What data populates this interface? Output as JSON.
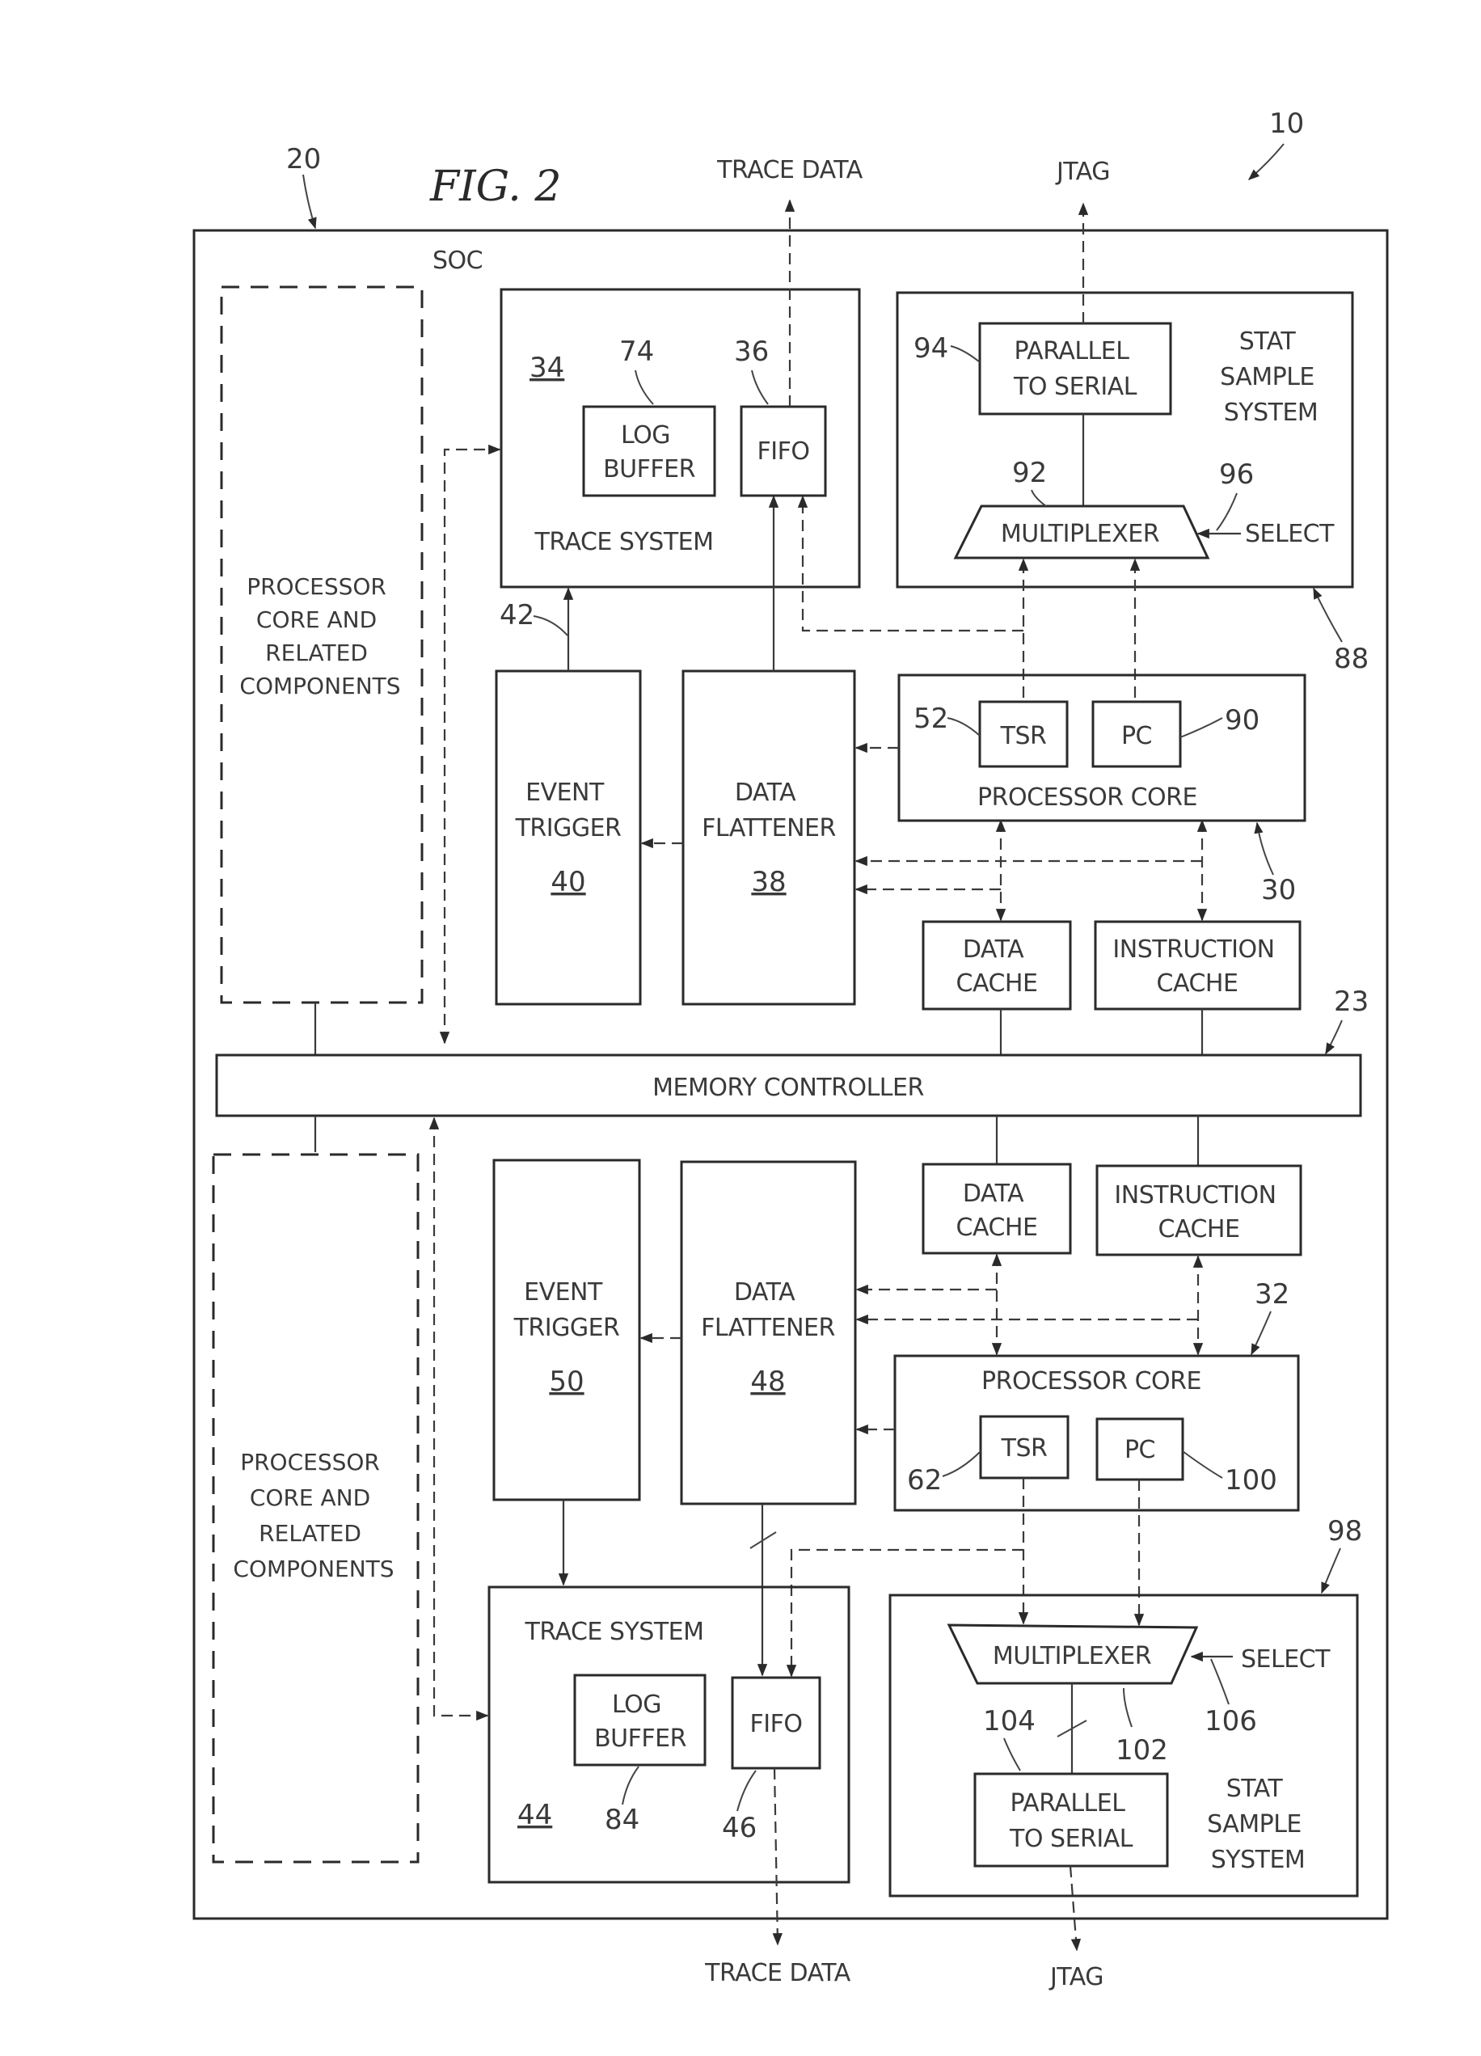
{
  "figure": {
    "title": "FIG. 2",
    "system_ref": "10",
    "soc_ref": "20",
    "soc_label": "SOC"
  },
  "external": {
    "trace_data_top": "TRACE DATA",
    "jtag_top": "JTAG",
    "trace_data_bottom": "TRACE DATA",
    "jtag_bottom": "JTAG"
  },
  "memory_controller": {
    "label": "MEMORY CONTROLLER",
    "ref": "23"
  },
  "upper": {
    "other_core": {
      "lines": [
        "PROCESSOR",
        "CORE AND",
        "RELATED",
        "COMPONENTS"
      ]
    },
    "trace_system": {
      "label": "TRACE SYSTEM",
      "ref": "34"
    },
    "log_buffer": {
      "lines": [
        "LOG",
        "BUFFER"
      ],
      "ref": "74"
    },
    "fifo": {
      "label": "FIFO",
      "ref": "36"
    },
    "stat_sample": {
      "lines": [
        "STAT",
        "SAMPLE",
        "SYSTEM"
      ],
      "ref": "88"
    },
    "parallel_to_serial": {
      "lines": [
        "PARALLEL",
        "TO SERIAL"
      ],
      "ref": "94"
    },
    "multiplexer": {
      "label": "MULTIPLEXER",
      "ref": "92"
    },
    "select": {
      "label": "SELECT",
      "ref": "96"
    },
    "event_trigger": {
      "lines": [
        "EVENT",
        "TRIGGER"
      ],
      "ref": "40",
      "link_ref": "42"
    },
    "data_flattener": {
      "lines": [
        "DATA",
        "FLATTENER"
      ],
      "ref": "38"
    },
    "processor_core": {
      "label": "PROCESSOR CORE",
      "ref": "30"
    },
    "tsr": {
      "label": "TSR",
      "ref": "52"
    },
    "pc": {
      "label": "PC",
      "ref": "90"
    },
    "data_cache": {
      "lines": [
        "DATA",
        "CACHE"
      ]
    },
    "instruction_cache": {
      "lines": [
        "INSTRUCTION",
        "CACHE"
      ]
    }
  },
  "lower": {
    "other_core": {
      "lines": [
        "PROCESSOR",
        "CORE AND",
        "RELATED",
        "COMPONENTS"
      ]
    },
    "data_cache": {
      "lines": [
        "DATA",
        "CACHE"
      ]
    },
    "instruction_cache": {
      "lines": [
        "INSTRUCTION",
        "CACHE"
      ]
    },
    "event_trigger": {
      "lines": [
        "EVENT",
        "TRIGGER"
      ],
      "ref": "50"
    },
    "data_flattener": {
      "lines": [
        "DATA",
        "FLATTENER"
      ],
      "ref": "48"
    },
    "processor_core": {
      "label": "PROCESSOR CORE",
      "ref": "32"
    },
    "tsr": {
      "label": "TSR",
      "ref": "62"
    },
    "pc": {
      "label": "PC",
      "ref": "100"
    },
    "trace_system": {
      "label": "TRACE SYSTEM",
      "ref": "44"
    },
    "log_buffer": {
      "lines": [
        "LOG",
        "BUFFER"
      ],
      "ref": "84"
    },
    "fifo": {
      "label": "FIFO",
      "ref": "46"
    },
    "stat_sample": {
      "lines": [
        "STAT",
        "SAMPLE",
        "SYSTEM"
      ],
      "ref": "98"
    },
    "multiplexer": {
      "label": "MULTIPLEXER",
      "ref": "102"
    },
    "select": {
      "label": "SELECT",
      "ref": "106"
    },
    "parallel_to_serial": {
      "lines": [
        "PARALLEL",
        "TO SERIAL"
      ],
      "ref": "104"
    }
  }
}
